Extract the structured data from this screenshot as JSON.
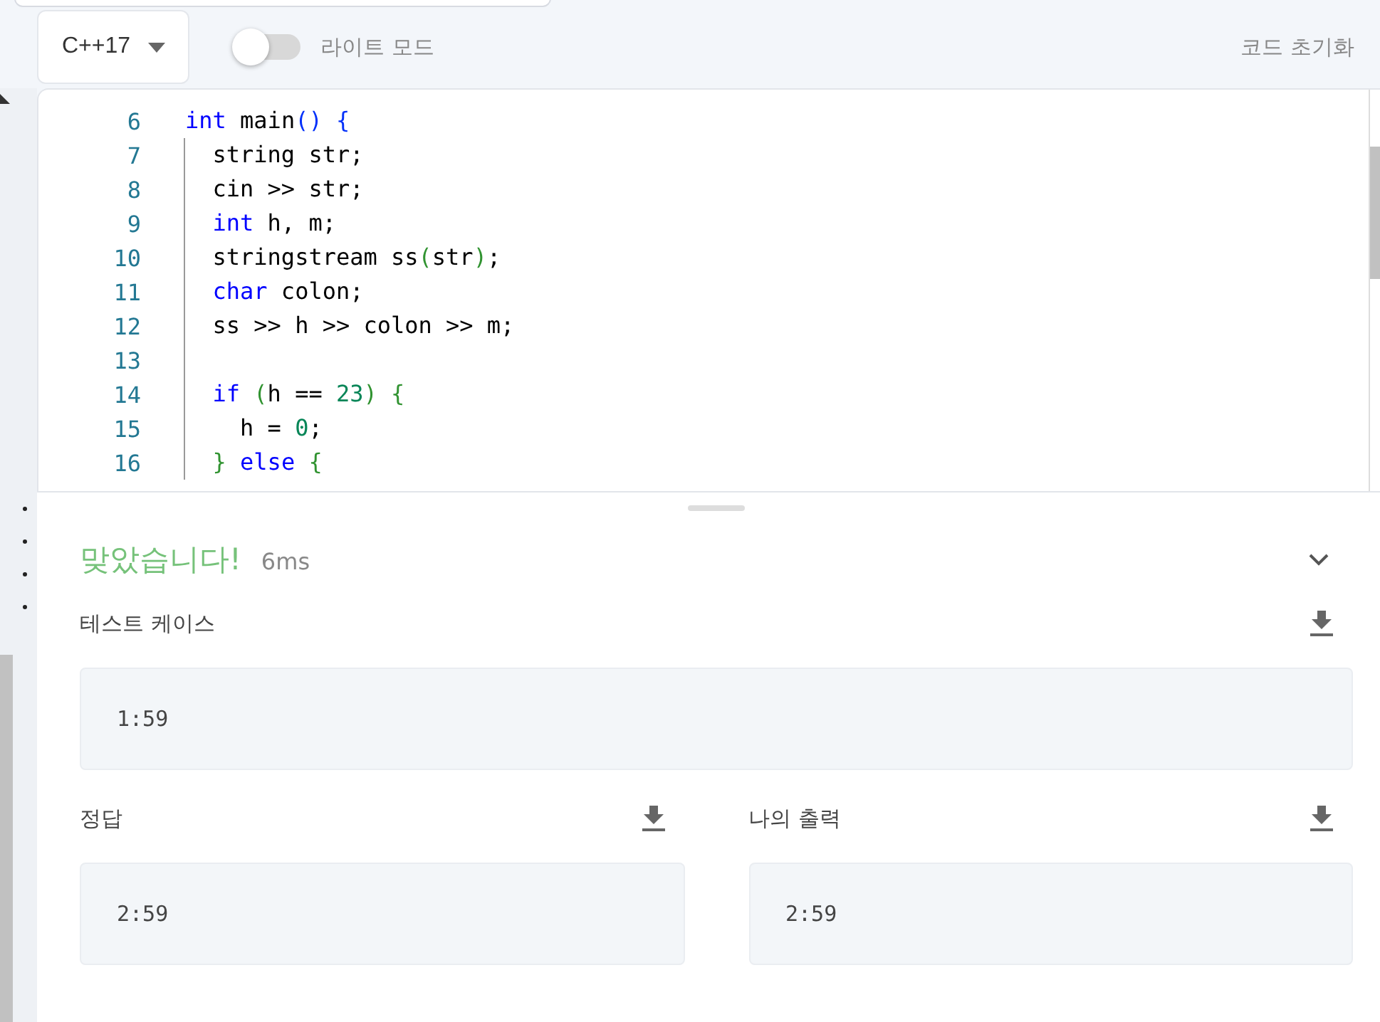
{
  "toolbar": {
    "language": "C++17",
    "theme_toggle": {
      "label": "라이트 모드",
      "on": false
    },
    "reset_label": "코드 초기화"
  },
  "editor": {
    "lines": [
      {
        "number": "6",
        "guide": false,
        "tokens": [
          {
            "text": "int",
            "kind": "keyword"
          },
          {
            "text": " main",
            "kind": "plain"
          },
          {
            "text": "()",
            "kind": "bracket1"
          },
          {
            "text": " {",
            "kind": "bracket1"
          }
        ],
        "children": [
          {
            "number": "7",
            "guide": true,
            "tokens": [
              {
                "text": "string str;",
                "kind": "plain"
              }
            ]
          },
          {
            "number": "8",
            "guide": true,
            "tokens": [
              {
                "text": "cin >> str;",
                "kind": "plain"
              }
            ]
          },
          {
            "number": "9",
            "guide": true,
            "tokens": [
              {
                "text": "int",
                "kind": "keyword"
              },
              {
                "text": " h, m;",
                "kind": "plain"
              }
            ]
          },
          {
            "number": "10",
            "guide": true,
            "tokens": [
              {
                "text": "stringstream ss",
                "kind": "plain"
              },
              {
                "text": "(",
                "kind": "bracket2"
              },
              {
                "text": "str",
                "kind": "plain"
              },
              {
                "text": ")",
                "kind": "bracket2"
              },
              {
                "text": ";",
                "kind": "plain"
              }
            ]
          },
          {
            "number": "11",
            "guide": true,
            "tokens": [
              {
                "text": "char",
                "kind": "keyword"
              },
              {
                "text": " colon;",
                "kind": "plain"
              }
            ]
          },
          {
            "number": "12",
            "guide": true,
            "tokens": [
              {
                "text": "ss >> h >> colon >> m;",
                "kind": "plain"
              }
            ]
          },
          {
            "number": "13",
            "guide": true
          },
          {
            "number": "14",
            "guide": true,
            "tokens": [
              {
                "text": "if",
                "kind": "keyword"
              },
              {
                "text": " (",
                "kind": "bracket2"
              },
              {
                "text": "h == ",
                "kind": "plain"
              },
              {
                "text": "23",
                "kind": "number"
              },
              {
                "text": ")",
                "kind": "bracket2"
              },
              {
                "text": " {",
                "kind": "bracket2"
              }
            ],
            "children": [
              {
                "number": "15",
                "guide": true,
                "tokens": [
                  {
                    "text": "h = ",
                    "kind": "plain"
                  },
                  {
                    "text": "0",
                    "kind": "number"
                  },
                  {
                    "text": ";",
                    "kind": "plain"
                  }
                ]
              }
            ]
          },
          {
            "number": "16",
            "guide": true,
            "tokens": [
              {
                "text": "}",
                "kind": "bracket2"
              },
              {
                "text": " else",
                "kind": "keyword"
              },
              {
                "text": " {",
                "kind": "bracket2"
              }
            ]
          }
        ]
      }
    ]
  },
  "result": {
    "verdict": "맞았습니다!",
    "time": "6ms",
    "expanded": true,
    "test_case": {
      "label": "테스트 케이스",
      "value": "1:59"
    },
    "answer": {
      "label": "정답",
      "value": "2:59"
    },
    "my_output": {
      "label": "나의 출력",
      "value": "2:59"
    }
  }
}
